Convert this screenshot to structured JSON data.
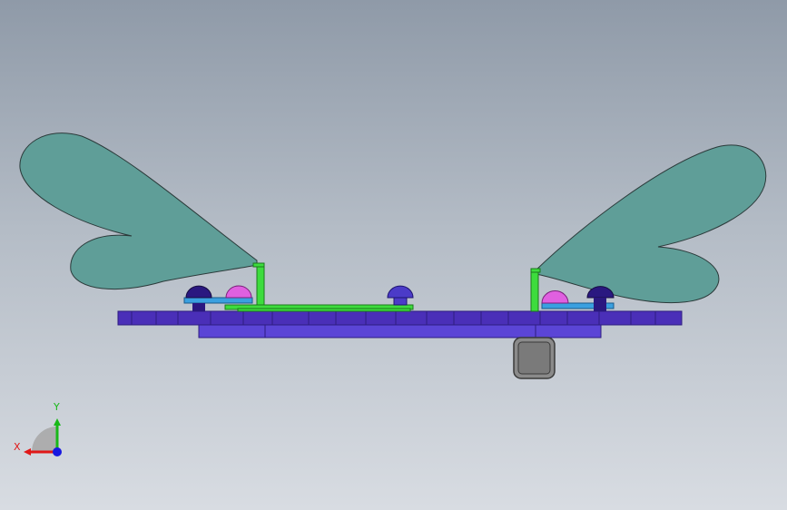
{
  "scene": {
    "background_top": "#8f9aa8",
    "background_bottom": "#d8dce2",
    "colors": {
      "wing_fill": "#5f9e98",
      "wing_stroke": "#2b3a3a",
      "base_plate": "#4a2fb8",
      "base_plate_dark": "#2e1d80",
      "lower_plate": "#5b45d6",
      "green_frame": "#3ddc3d",
      "dome_dark": "#2a1880",
      "dome_mid": "#4b3bc8",
      "dome_pink": "#e060e0",
      "blue_pad": "#3aa0e0",
      "motor_fill": "#8a8a8a",
      "motor_stroke": "#3a3a3a"
    }
  },
  "triad": {
    "x_label": "X",
    "y_label": "Y",
    "x_color": "#e01818",
    "y_color": "#18b818",
    "z_color": "#1818e0"
  }
}
